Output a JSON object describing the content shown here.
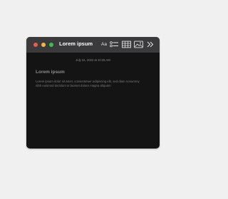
{
  "window": {
    "title": "Lorem ipsum",
    "traffic_lights": {
      "close_color": "#ee5b4f",
      "minimize_color": "#f2b53d",
      "zoom_color": "#3fbd4b"
    }
  },
  "toolbar": {
    "items": [
      {
        "icon": "text-format-icon",
        "label": "Aa"
      },
      {
        "icon": "checklist-icon"
      },
      {
        "icon": "table-icon"
      },
      {
        "icon": "media-icon"
      },
      {
        "icon": "chevron-double-right-icon"
      }
    ]
  },
  "note": {
    "date": "July 31, 2022 at 10:25 AM",
    "title": "Lorem ipsum",
    "body": "Lorem ipsum dolor sit amet, consectetuer adipiscing elit, sed diam nonummy nibh euismod tincidunt ut laoreet dolore magna aliquam"
  },
  "colors": {
    "background": "#f0f0f0",
    "titlebar": "#3a3a3c",
    "content": "#141414"
  }
}
